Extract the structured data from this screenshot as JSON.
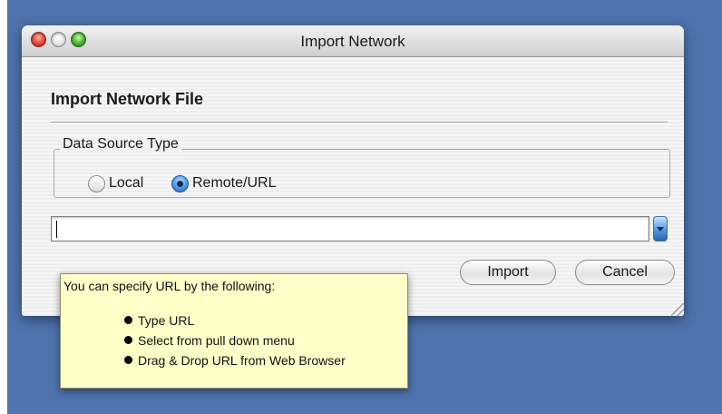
{
  "window": {
    "title": "Import Network"
  },
  "dialog": {
    "heading": "Import Network File",
    "data_source": {
      "group_label": "Data Source Type",
      "options": [
        "Local",
        "Remote/URL"
      ],
      "selected": "Remote/URL"
    },
    "url_field": {
      "value": "",
      "placeholder": ""
    },
    "buttons": {
      "import_label": "Import",
      "cancel_label": "Cancel"
    }
  },
  "tooltip": {
    "title": "You can specify URL by the following:",
    "items": [
      "Type URL",
      "Select from pull down menu",
      "Drag & Drop URL from Web Browser"
    ]
  },
  "icons": {
    "close": "close-icon",
    "minimize": "minimize-icon",
    "zoom": "zoom-icon",
    "dropdown": "chevron-down-icon",
    "resize": "resize-grip-icon"
  },
  "colors": {
    "desktop": "#4e73ad",
    "tooltip_background": "#ffffc8",
    "accent": "#4c95e3"
  }
}
